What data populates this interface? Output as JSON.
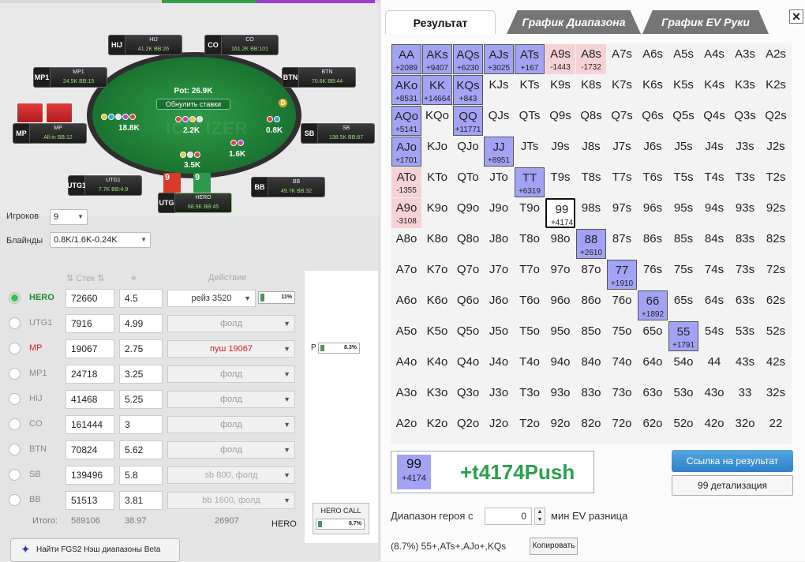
{
  "table": {
    "pot": "Pot: 26.9K",
    "reset_label": "Обнулить ставки",
    "watermark": "ICM IZER",
    "dealer": "D",
    "bet_labels": [
      "18.8K",
      "2.2K",
      "0.8K",
      "1.6K",
      "3.5K"
    ],
    "seats": [
      {
        "pos": "HIJ",
        "name": "HIJ",
        "stack": "41.2K BB:26"
      },
      {
        "pos": "CO",
        "name": "CO",
        "stack": "161.2K BB:101"
      },
      {
        "pos": "MP1",
        "name": "MP1",
        "stack": "24.5K BB:15"
      },
      {
        "pos": "BTN",
        "name": "BTN",
        "stack": "70.6K BB:44"
      },
      {
        "pos": "MP",
        "name": "MP",
        "stack": "All-in BB:12"
      },
      {
        "pos": "SB",
        "name": "SB",
        "stack": "138.5K BB:87"
      },
      {
        "pos": "UTG1",
        "name": "UTG1",
        "stack": "7.7K BB:4.9"
      },
      {
        "pos": "BB",
        "name": "BB",
        "stack": "49.7K BB:32"
      },
      {
        "pos": "UTG",
        "name": "HERO",
        "stack": "68.9K BB:45"
      }
    ],
    "hero_cards": [
      "9",
      "9"
    ]
  },
  "controls": {
    "players_label": "Игроков",
    "players_value": "9",
    "blinds_label": "Блайнды",
    "blinds_value": "0.8K/1.6K-0.24K"
  },
  "columns": {
    "stack": "Стек",
    "action": "Действие"
  },
  "players": [
    {
      "name": "HERO",
      "stack": "72660",
      "bb": "4.5",
      "action": "рейз 3520",
      "pct": "11%"
    },
    {
      "name": "UTG1",
      "stack": "7916",
      "bb": "4.99",
      "action": "фолд"
    },
    {
      "name": "MP",
      "stack": "19067",
      "bb": "2.75",
      "action": "пуш 19067"
    },
    {
      "name": "MP1",
      "stack": "24718",
      "bb": "3.25",
      "action": "фолд"
    },
    {
      "name": "HIJ",
      "stack": "41468",
      "bb": "5.25",
      "action": "фолд"
    },
    {
      "name": "CO",
      "stack": "161444",
      "bb": "3",
      "action": "фолд"
    },
    {
      "name": "BTN",
      "stack": "70824",
      "bb": "5.62",
      "action": "фолд"
    },
    {
      "name": "SB",
      "stack": "139496",
      "bb": "5.8",
      "action": "sb 800, фолд"
    },
    {
      "name": "BB",
      "stack": "51513",
      "bb": "3.81",
      "action": "bb 1600, фолд"
    }
  ],
  "totals": {
    "label": "Итого:",
    "stack": "589106",
    "bb": "38.97",
    "action": "26907",
    "hero": "HERO"
  },
  "middle": {
    "p_label": "P",
    "p_pct": "8.3%",
    "hero_call_label": "HERO CALL",
    "hero_call_pct": "8.7%"
  },
  "fgs2_button": "Найти FGS2 Нэш диапазоны Beta",
  "tabs": [
    "Результат",
    "График Диапазона",
    "График EV Руки"
  ],
  "close": "✕",
  "grid": [
    [
      [
        "AA",
        "+2089"
      ],
      [
        "AKs",
        "+9407"
      ],
      [
        "AQs",
        "+6230"
      ],
      [
        "AJs",
        "+3025"
      ],
      [
        "ATs",
        "+167"
      ],
      [
        "A9s",
        "-1443"
      ],
      [
        "A8s",
        "-1732"
      ],
      [
        "A7s",
        ""
      ],
      [
        "A6s",
        ""
      ],
      [
        "A5s",
        ""
      ],
      [
        "A4s",
        ""
      ],
      [
        "A3s",
        ""
      ],
      [
        "A2s",
        ""
      ]
    ],
    [
      [
        "AKo",
        "+8531"
      ],
      [
        "KK",
        "+14664"
      ],
      [
        "KQs",
        "+843"
      ],
      [
        "KJs",
        ""
      ],
      [
        "KTs",
        ""
      ],
      [
        "K9s",
        ""
      ],
      [
        "K8s",
        ""
      ],
      [
        "K7s",
        ""
      ],
      [
        "K6s",
        ""
      ],
      [
        "K5s",
        ""
      ],
      [
        "K4s",
        ""
      ],
      [
        "K3s",
        ""
      ],
      [
        "K2s",
        ""
      ]
    ],
    [
      [
        "AQo",
        "+5141"
      ],
      [
        "KQo",
        ""
      ],
      [
        "QQ",
        "+11771"
      ],
      [
        "QJs",
        ""
      ],
      [
        "QTs",
        ""
      ],
      [
        "Q9s",
        ""
      ],
      [
        "Q8s",
        ""
      ],
      [
        "Q7s",
        ""
      ],
      [
        "Q6s",
        ""
      ],
      [
        "Q5s",
        ""
      ],
      [
        "Q4s",
        ""
      ],
      [
        "Q3s",
        ""
      ],
      [
        "Q2s",
        ""
      ]
    ],
    [
      [
        "AJo",
        "+1701"
      ],
      [
        "KJo",
        ""
      ],
      [
        "QJo",
        ""
      ],
      [
        "JJ",
        "+8951"
      ],
      [
        "JTs",
        ""
      ],
      [
        "J9s",
        ""
      ],
      [
        "J8s",
        ""
      ],
      [
        "J7s",
        ""
      ],
      [
        "J6s",
        ""
      ],
      [
        "J5s",
        ""
      ],
      [
        "J4s",
        ""
      ],
      [
        "J3s",
        ""
      ],
      [
        "J2s",
        ""
      ]
    ],
    [
      [
        "ATo",
        "-1355"
      ],
      [
        "KTo",
        ""
      ],
      [
        "QTo",
        ""
      ],
      [
        "JTo",
        ""
      ],
      [
        "TT",
        "+6319"
      ],
      [
        "T9s",
        ""
      ],
      [
        "T8s",
        ""
      ],
      [
        "T7s",
        ""
      ],
      [
        "T6s",
        ""
      ],
      [
        "T5s",
        ""
      ],
      [
        "T4s",
        ""
      ],
      [
        "T3s",
        ""
      ],
      [
        "T2s",
        ""
      ]
    ],
    [
      [
        "A9o",
        "-3108"
      ],
      [
        "K9o",
        ""
      ],
      [
        "Q9o",
        ""
      ],
      [
        "J9o",
        ""
      ],
      [
        "T9o",
        ""
      ],
      [
        "99",
        "+4174"
      ],
      [
        "98s",
        ""
      ],
      [
        "97s",
        ""
      ],
      [
        "96s",
        ""
      ],
      [
        "95s",
        ""
      ],
      [
        "94s",
        ""
      ],
      [
        "93s",
        ""
      ],
      [
        "92s",
        ""
      ]
    ],
    [
      [
        "A8o",
        ""
      ],
      [
        "K8o",
        ""
      ],
      [
        "Q8o",
        ""
      ],
      [
        "J8o",
        ""
      ],
      [
        "T8o",
        ""
      ],
      [
        "98o",
        ""
      ],
      [
        "88",
        "+2610"
      ],
      [
        "87s",
        ""
      ],
      [
        "86s",
        ""
      ],
      [
        "85s",
        ""
      ],
      [
        "84s",
        ""
      ],
      [
        "83s",
        ""
      ],
      [
        "82s",
        ""
      ]
    ],
    [
      [
        "A7o",
        ""
      ],
      [
        "K7o",
        ""
      ],
      [
        "Q7o",
        ""
      ],
      [
        "J7o",
        ""
      ],
      [
        "T7o",
        ""
      ],
      [
        "97o",
        ""
      ],
      [
        "87o",
        ""
      ],
      [
        "77",
        "+1910"
      ],
      [
        "76s",
        ""
      ],
      [
        "75s",
        ""
      ],
      [
        "74s",
        ""
      ],
      [
        "73s",
        ""
      ],
      [
        "72s",
        ""
      ]
    ],
    [
      [
        "A6o",
        ""
      ],
      [
        "K6o",
        ""
      ],
      [
        "Q6o",
        ""
      ],
      [
        "J6o",
        ""
      ],
      [
        "T6o",
        ""
      ],
      [
        "96o",
        ""
      ],
      [
        "86o",
        ""
      ],
      [
        "76o",
        ""
      ],
      [
        "66",
        "+1892"
      ],
      [
        "65s",
        ""
      ],
      [
        "64s",
        ""
      ],
      [
        "63s",
        ""
      ],
      [
        "62s",
        ""
      ]
    ],
    [
      [
        "A5o",
        ""
      ],
      [
        "K5o",
        ""
      ],
      [
        "Q5o",
        ""
      ],
      [
        "J5o",
        ""
      ],
      [
        "T5o",
        ""
      ],
      [
        "95o",
        ""
      ],
      [
        "85o",
        ""
      ],
      [
        "75o",
        ""
      ],
      [
        "65o",
        ""
      ],
      [
        "55",
        "+1791"
      ],
      [
        "54s",
        ""
      ],
      [
        "53s",
        ""
      ],
      [
        "52s",
        ""
      ]
    ],
    [
      [
        "A4o",
        ""
      ],
      [
        "K4o",
        ""
      ],
      [
        "Q4o",
        ""
      ],
      [
        "J4o",
        ""
      ],
      [
        "T4o",
        ""
      ],
      [
        "94o",
        ""
      ],
      [
        "84o",
        ""
      ],
      [
        "74o",
        ""
      ],
      [
        "64o",
        ""
      ],
      [
        "54o",
        ""
      ],
      [
        "44",
        ""
      ],
      [
        "43s",
        ""
      ],
      [
        "42s",
        ""
      ]
    ],
    [
      [
        "A3o",
        ""
      ],
      [
        "K3o",
        ""
      ],
      [
        "Q3o",
        ""
      ],
      [
        "J3o",
        ""
      ],
      [
        "T3o",
        ""
      ],
      [
        "93o",
        ""
      ],
      [
        "83o",
        ""
      ],
      [
        "73o",
        ""
      ],
      [
        "63o",
        ""
      ],
      [
        "53o",
        ""
      ],
      [
        "43o",
        ""
      ],
      [
        "33",
        ""
      ],
      [
        "32s",
        ""
      ]
    ],
    [
      [
        "A2o",
        ""
      ],
      [
        "K2o",
        ""
      ],
      [
        "Q2o",
        ""
      ],
      [
        "J2o",
        ""
      ],
      [
        "T2o",
        ""
      ],
      [
        "92o",
        ""
      ],
      [
        "82o",
        ""
      ],
      [
        "72o",
        ""
      ],
      [
        "62o",
        ""
      ],
      [
        "52o",
        ""
      ],
      [
        "42o",
        ""
      ],
      [
        "32o",
        ""
      ],
      [
        "22",
        ""
      ]
    ]
  ],
  "selected_hand": "99",
  "result": {
    "hand": "99",
    "ev": "+4174",
    "text": "+t4174Push"
  },
  "buttons": {
    "link": "Ссылка на результат",
    "detail": "99 детализация",
    "copy": "Копировать"
  },
  "range": {
    "label": "Диапазон героя с",
    "value": "0",
    "suffix": "мин EV разница",
    "summary": "(8.7%) 55+,ATs+,AJo+,KQs"
  },
  "colors": {
    "positive": "#a3a3f5",
    "negative": "#f6d2d6",
    "felt": "#1d7a34",
    "accent_green": "#2aa14a"
  }
}
